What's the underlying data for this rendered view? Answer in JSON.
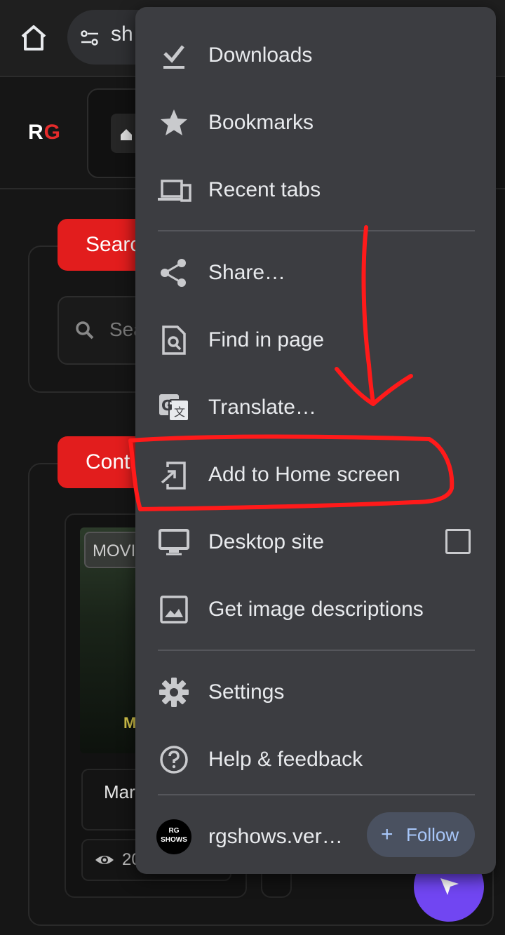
{
  "browser": {
    "url_text": "sh",
    "home_icon": "home-icon",
    "tune_icon": "page-info-icon"
  },
  "site": {
    "logo_r": "R",
    "logo_g": "G",
    "search_button": "Searc",
    "search_placeholder": "Sea",
    "content_button": "Cont",
    "movie_tag": "MOVI",
    "poster_letter": "M",
    "movie_title": "Mar",
    "views": "20",
    "accent_color": "#e21d1d",
    "fab_color": "#7146f2"
  },
  "menu": {
    "items": [
      {
        "label": "Downloads",
        "icon": "download-icon"
      },
      {
        "label": "Bookmarks",
        "icon": "star-icon"
      },
      {
        "label": "Recent tabs",
        "icon": "devices-icon"
      },
      {
        "label": "Share…",
        "icon": "share-icon"
      },
      {
        "label": "Find in page",
        "icon": "find-in-page-icon"
      },
      {
        "label": "Translate…",
        "icon": "translate-icon"
      },
      {
        "label": "Add to Home screen",
        "icon": "add-to-home-screen-icon"
      },
      {
        "label": "Desktop site",
        "icon": "desktop-icon",
        "checked": false
      },
      {
        "label": "Get image descriptions",
        "icon": "image-icon"
      },
      {
        "label": "Settings",
        "icon": "gear-icon"
      },
      {
        "label": "Help & feedback",
        "icon": "help-icon"
      }
    ],
    "site_avatar_top": "RG",
    "site_avatar_bottom": "SHOWS",
    "site_name": "rgshows.ver…",
    "follow_plus": "+",
    "follow_label": "Follow",
    "background_color": "#3c3d41"
  },
  "annotation": {
    "color": "#ff1a1a",
    "highlighted_item": "Add to Home screen"
  }
}
